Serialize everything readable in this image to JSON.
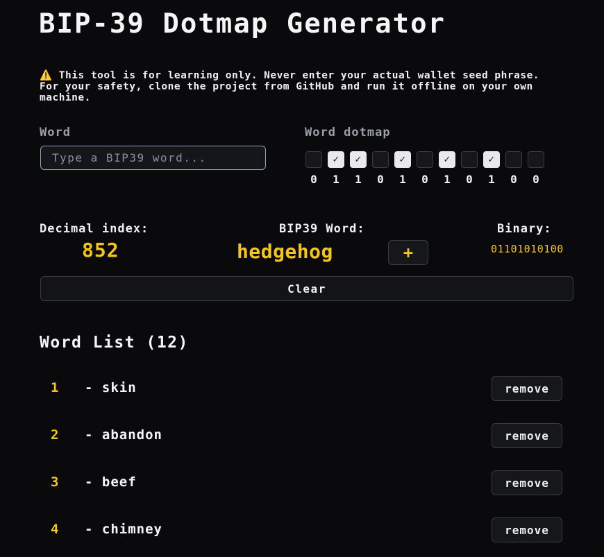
{
  "header": {
    "title": "BIP-39 Dotmap Generator"
  },
  "warning": {
    "icon": "warning-icon",
    "icon_glyph": "⚠️",
    "text": "This tool is for learning only. Never enter your actual wallet seed phrase. For your safety, clone the project from GitHub and run it offline on your own machine."
  },
  "input": {
    "label": "Word",
    "placeholder": "Type a BIP39 word...",
    "value": ""
  },
  "dotmap": {
    "label": "Word dotmap",
    "bits": [
      0,
      1,
      1,
      0,
      1,
      0,
      1,
      0,
      1,
      0,
      0
    ],
    "check_glyph": "✓"
  },
  "stats": {
    "decimal_label": "Decimal index:",
    "decimal_value": "852",
    "word_label": "BIP39 Word:",
    "word_value": "hedgehog",
    "binary_label": "Binary:",
    "binary_value": "01101010100"
  },
  "actions": {
    "add_label": "+",
    "clear_label": "Clear"
  },
  "word_list": {
    "title": "Word List (12)",
    "separator": "-",
    "remove_label": "remove",
    "items": [
      {
        "index": "1",
        "word": "skin"
      },
      {
        "index": "2",
        "word": "abandon"
      },
      {
        "index": "3",
        "word": "beef"
      },
      {
        "index": "4",
        "word": "chimney"
      }
    ]
  },
  "colors": {
    "background": "#0a0a0c",
    "accent": "#f5c518",
    "muted": "#9aa0aa",
    "input_border": "#8ea4c4"
  }
}
